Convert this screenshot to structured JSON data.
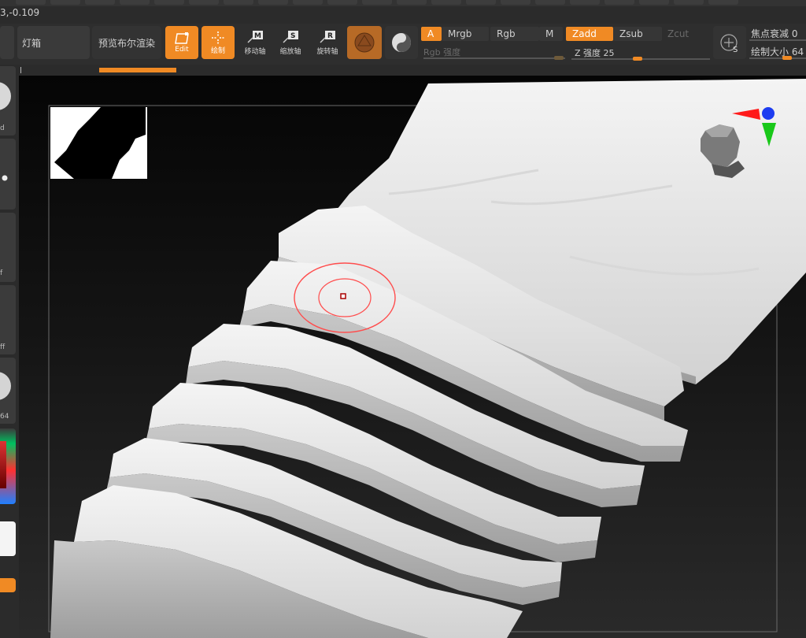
{
  "status": {
    "coords": "3,-0.109"
  },
  "toolbar": {
    "lightbox_label": "灯箱",
    "bpr_label": "预览布尔渲染",
    "edit_label": "Edit",
    "draw_label": "绘制",
    "move_label": "移动轴",
    "scale_label": "缩放轴",
    "rotate_label": "旋转轴",
    "move_key": "M",
    "scale_key": "S",
    "rotate_key": "R"
  },
  "color_modes": {
    "a_label": "A",
    "mrgb_label": "Mrgb",
    "rgb_label": "Rgb",
    "m_label": "M",
    "rgb_intensity_label": "Rgb 强度"
  },
  "z_modes": {
    "zadd_label": "Zadd",
    "zsub_label": "Zsub",
    "zcut_label": "Zcut",
    "z_intensity_label": "Z 强度 25",
    "z_intensity_value": 25
  },
  "brush": {
    "focal_shift_label": "焦点衰减 0",
    "draw_size_label": "绘制大小 64",
    "s_key": "S"
  },
  "left_shelf": {
    "labels": [
      "d",
      "f",
      "ff",
      "64"
    ]
  },
  "colors": {
    "accent": "#f08a24",
    "panel": "#2e2e2e",
    "button": "#3a3a3a",
    "gizmo_red": "#ff1a1a",
    "gizmo_green": "#19c819",
    "gizmo_blue": "#1d3cf0",
    "cursor_ring": "#ff4d4d"
  }
}
